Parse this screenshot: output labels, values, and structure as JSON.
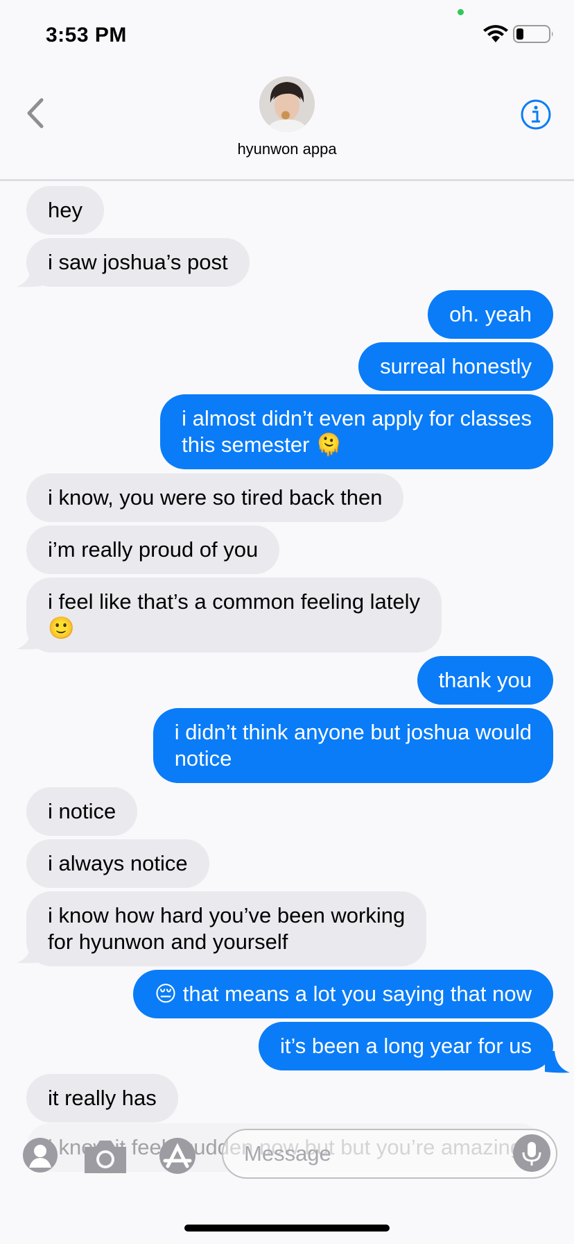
{
  "status_bar": {
    "time": "3:53 PM"
  },
  "header": {
    "contact_name": "hyunwon appa"
  },
  "messages": [
    {
      "from": "them",
      "text": "hey"
    },
    {
      "from": "them",
      "text": "i saw joshua’s post"
    },
    {
      "from": "me",
      "text": "oh. yeah"
    },
    {
      "from": "me",
      "text": "surreal honestly"
    },
    {
      "from": "me",
      "text": "i almost didn’t even apply for classes\nthis semester 🫠"
    },
    {
      "from": "them",
      "text": "i know, you were so tired back then"
    },
    {
      "from": "them",
      "text": "i’m really proud of you"
    },
    {
      "from": "them",
      "text": "i feel like that’s a common feeling lately\n🙂"
    },
    {
      "from": "me",
      "text": "thank you"
    },
    {
      "from": "me",
      "text": "i didn’t think anyone but joshua would\nnotice"
    },
    {
      "from": "them",
      "text": "i notice"
    },
    {
      "from": "them",
      "text": "i always notice"
    },
    {
      "from": "them",
      "text": "i know how hard you’ve been working\nfor hyunwon and yourself"
    },
    {
      "from": "me",
      "text": "😔 that means a lot you saying that now"
    },
    {
      "from": "me",
      "text": "it’s been a long year for us"
    },
    {
      "from": "them",
      "text": "it really has"
    },
    {
      "from": "them",
      "text": "i know it feels sudden now but\nbut you’re amazing"
    }
  ],
  "input": {
    "placeholder": "Message"
  },
  "icons": {
    "back": "chevron-left-icon",
    "info": "info-icon",
    "contact": "contact-icon",
    "camera": "camera-icon",
    "appstore": "app-store-icon",
    "mic": "microphone-icon"
  },
  "colors": {
    "accent": "#0a7cf7",
    "incoming_bubble": "#e9e9ee",
    "background": "#f9f9fb"
  }
}
